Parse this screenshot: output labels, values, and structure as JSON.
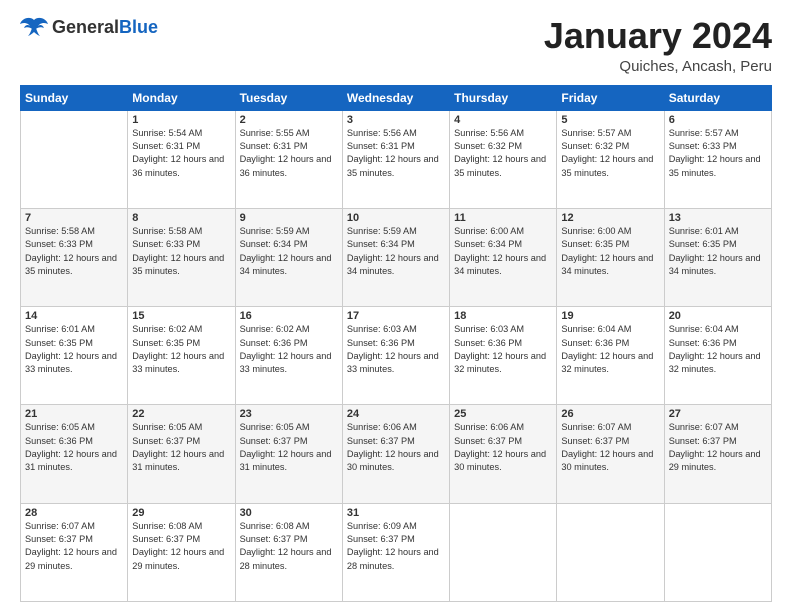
{
  "header": {
    "logo_general": "General",
    "logo_blue": "Blue",
    "title": "January 2024",
    "location": "Quiches, Ancash, Peru"
  },
  "days_of_week": [
    "Sunday",
    "Monday",
    "Tuesday",
    "Wednesday",
    "Thursday",
    "Friday",
    "Saturday"
  ],
  "weeks": [
    [
      {
        "day": "",
        "sunrise": "",
        "sunset": "",
        "daylight": ""
      },
      {
        "day": "1",
        "sunrise": "Sunrise: 5:54 AM",
        "sunset": "Sunset: 6:31 PM",
        "daylight": "Daylight: 12 hours and 36 minutes."
      },
      {
        "day": "2",
        "sunrise": "Sunrise: 5:55 AM",
        "sunset": "Sunset: 6:31 PM",
        "daylight": "Daylight: 12 hours and 36 minutes."
      },
      {
        "day": "3",
        "sunrise": "Sunrise: 5:56 AM",
        "sunset": "Sunset: 6:31 PM",
        "daylight": "Daylight: 12 hours and 35 minutes."
      },
      {
        "day": "4",
        "sunrise": "Sunrise: 5:56 AM",
        "sunset": "Sunset: 6:32 PM",
        "daylight": "Daylight: 12 hours and 35 minutes."
      },
      {
        "day": "5",
        "sunrise": "Sunrise: 5:57 AM",
        "sunset": "Sunset: 6:32 PM",
        "daylight": "Daylight: 12 hours and 35 minutes."
      },
      {
        "day": "6",
        "sunrise": "Sunrise: 5:57 AM",
        "sunset": "Sunset: 6:33 PM",
        "daylight": "Daylight: 12 hours and 35 minutes."
      }
    ],
    [
      {
        "day": "7",
        "sunrise": "Sunrise: 5:58 AM",
        "sunset": "Sunset: 6:33 PM",
        "daylight": "Daylight: 12 hours and 35 minutes."
      },
      {
        "day": "8",
        "sunrise": "Sunrise: 5:58 AM",
        "sunset": "Sunset: 6:33 PM",
        "daylight": "Daylight: 12 hours and 35 minutes."
      },
      {
        "day": "9",
        "sunrise": "Sunrise: 5:59 AM",
        "sunset": "Sunset: 6:34 PM",
        "daylight": "Daylight: 12 hours and 34 minutes."
      },
      {
        "day": "10",
        "sunrise": "Sunrise: 5:59 AM",
        "sunset": "Sunset: 6:34 PM",
        "daylight": "Daylight: 12 hours and 34 minutes."
      },
      {
        "day": "11",
        "sunrise": "Sunrise: 6:00 AM",
        "sunset": "Sunset: 6:34 PM",
        "daylight": "Daylight: 12 hours and 34 minutes."
      },
      {
        "day": "12",
        "sunrise": "Sunrise: 6:00 AM",
        "sunset": "Sunset: 6:35 PM",
        "daylight": "Daylight: 12 hours and 34 minutes."
      },
      {
        "day": "13",
        "sunrise": "Sunrise: 6:01 AM",
        "sunset": "Sunset: 6:35 PM",
        "daylight": "Daylight: 12 hours and 34 minutes."
      }
    ],
    [
      {
        "day": "14",
        "sunrise": "Sunrise: 6:01 AM",
        "sunset": "Sunset: 6:35 PM",
        "daylight": "Daylight: 12 hours and 33 minutes."
      },
      {
        "day": "15",
        "sunrise": "Sunrise: 6:02 AM",
        "sunset": "Sunset: 6:35 PM",
        "daylight": "Daylight: 12 hours and 33 minutes."
      },
      {
        "day": "16",
        "sunrise": "Sunrise: 6:02 AM",
        "sunset": "Sunset: 6:36 PM",
        "daylight": "Daylight: 12 hours and 33 minutes."
      },
      {
        "day": "17",
        "sunrise": "Sunrise: 6:03 AM",
        "sunset": "Sunset: 6:36 PM",
        "daylight": "Daylight: 12 hours and 33 minutes."
      },
      {
        "day": "18",
        "sunrise": "Sunrise: 6:03 AM",
        "sunset": "Sunset: 6:36 PM",
        "daylight": "Daylight: 12 hours and 32 minutes."
      },
      {
        "day": "19",
        "sunrise": "Sunrise: 6:04 AM",
        "sunset": "Sunset: 6:36 PM",
        "daylight": "Daylight: 12 hours and 32 minutes."
      },
      {
        "day": "20",
        "sunrise": "Sunrise: 6:04 AM",
        "sunset": "Sunset: 6:36 PM",
        "daylight": "Daylight: 12 hours and 32 minutes."
      }
    ],
    [
      {
        "day": "21",
        "sunrise": "Sunrise: 6:05 AM",
        "sunset": "Sunset: 6:36 PM",
        "daylight": "Daylight: 12 hours and 31 minutes."
      },
      {
        "day": "22",
        "sunrise": "Sunrise: 6:05 AM",
        "sunset": "Sunset: 6:37 PM",
        "daylight": "Daylight: 12 hours and 31 minutes."
      },
      {
        "day": "23",
        "sunrise": "Sunrise: 6:05 AM",
        "sunset": "Sunset: 6:37 PM",
        "daylight": "Daylight: 12 hours and 31 minutes."
      },
      {
        "day": "24",
        "sunrise": "Sunrise: 6:06 AM",
        "sunset": "Sunset: 6:37 PM",
        "daylight": "Daylight: 12 hours and 30 minutes."
      },
      {
        "day": "25",
        "sunrise": "Sunrise: 6:06 AM",
        "sunset": "Sunset: 6:37 PM",
        "daylight": "Daylight: 12 hours and 30 minutes."
      },
      {
        "day": "26",
        "sunrise": "Sunrise: 6:07 AM",
        "sunset": "Sunset: 6:37 PM",
        "daylight": "Daylight: 12 hours and 30 minutes."
      },
      {
        "day": "27",
        "sunrise": "Sunrise: 6:07 AM",
        "sunset": "Sunset: 6:37 PM",
        "daylight": "Daylight: 12 hours and 29 minutes."
      }
    ],
    [
      {
        "day": "28",
        "sunrise": "Sunrise: 6:07 AM",
        "sunset": "Sunset: 6:37 PM",
        "daylight": "Daylight: 12 hours and 29 minutes."
      },
      {
        "day": "29",
        "sunrise": "Sunrise: 6:08 AM",
        "sunset": "Sunset: 6:37 PM",
        "daylight": "Daylight: 12 hours and 29 minutes."
      },
      {
        "day": "30",
        "sunrise": "Sunrise: 6:08 AM",
        "sunset": "Sunset: 6:37 PM",
        "daylight": "Daylight: 12 hours and 28 minutes."
      },
      {
        "day": "31",
        "sunrise": "Sunrise: 6:09 AM",
        "sunset": "Sunset: 6:37 PM",
        "daylight": "Daylight: 12 hours and 28 minutes."
      },
      {
        "day": "",
        "sunrise": "",
        "sunset": "",
        "daylight": ""
      },
      {
        "day": "",
        "sunrise": "",
        "sunset": "",
        "daylight": ""
      },
      {
        "day": "",
        "sunrise": "",
        "sunset": "",
        "daylight": ""
      }
    ]
  ]
}
